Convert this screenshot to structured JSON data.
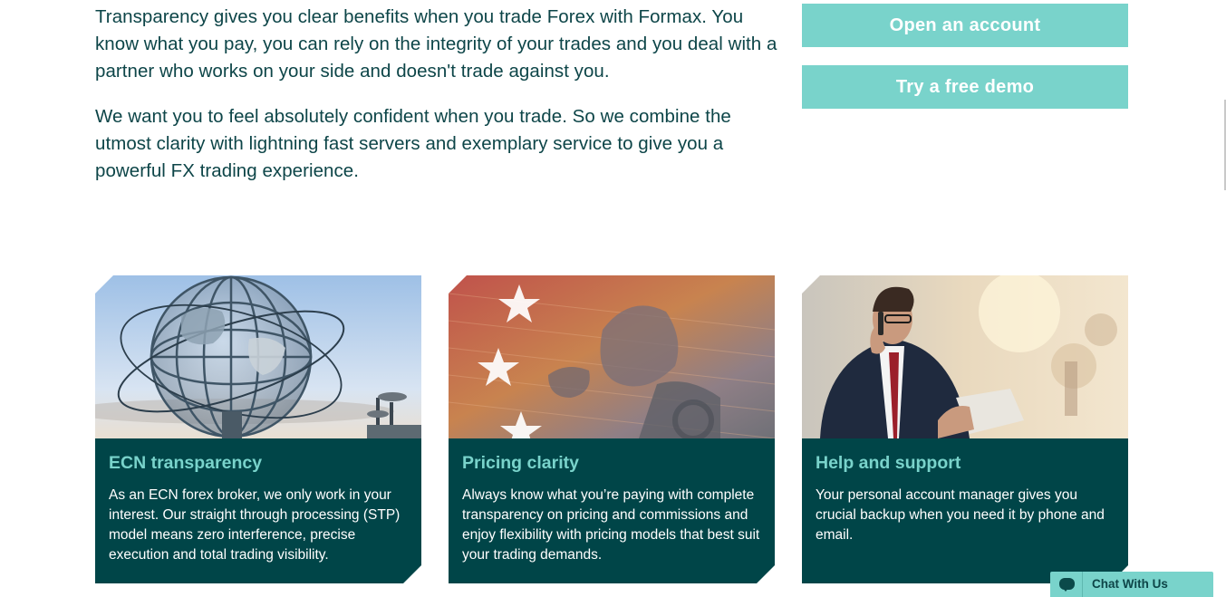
{
  "intro": {
    "paragraph_1": "Transparency gives you clear benefits when you trade Forex with Formax. You know what you pay, you can rely on the integrity of your trades and you deal with a partner who works on your side and doesn't trade against you.",
    "paragraph_2": "We want you to feel absolutely confident when you trade. So we combine the utmost clarity with lightning fast servers and exemplary service to give you a powerful FX trading experience."
  },
  "actions": {
    "open_account": "Open an account",
    "free_demo": "Try a free demo"
  },
  "cards": [
    {
      "title": "ECN transparency",
      "text": "As an ECN forex broker, we only work in your interest. Our straight through processing (STP) model means zero interference, precise execution and total trading visibility."
    },
    {
      "title": "Pricing clarity",
      "text": "Always know what you’re paying with complete transparency on pricing and commissions and enjoy flexibility with pricing models that best suit your trading demands."
    },
    {
      "title": "Help and support",
      "text": "Your personal account manager gives you crucial backup when you need it by phone and email."
    }
  ],
  "chat": {
    "label": "Chat With Us"
  },
  "colors": {
    "accent": "#79d3cb",
    "card_bg": "#004548",
    "text": "#0d4548"
  }
}
